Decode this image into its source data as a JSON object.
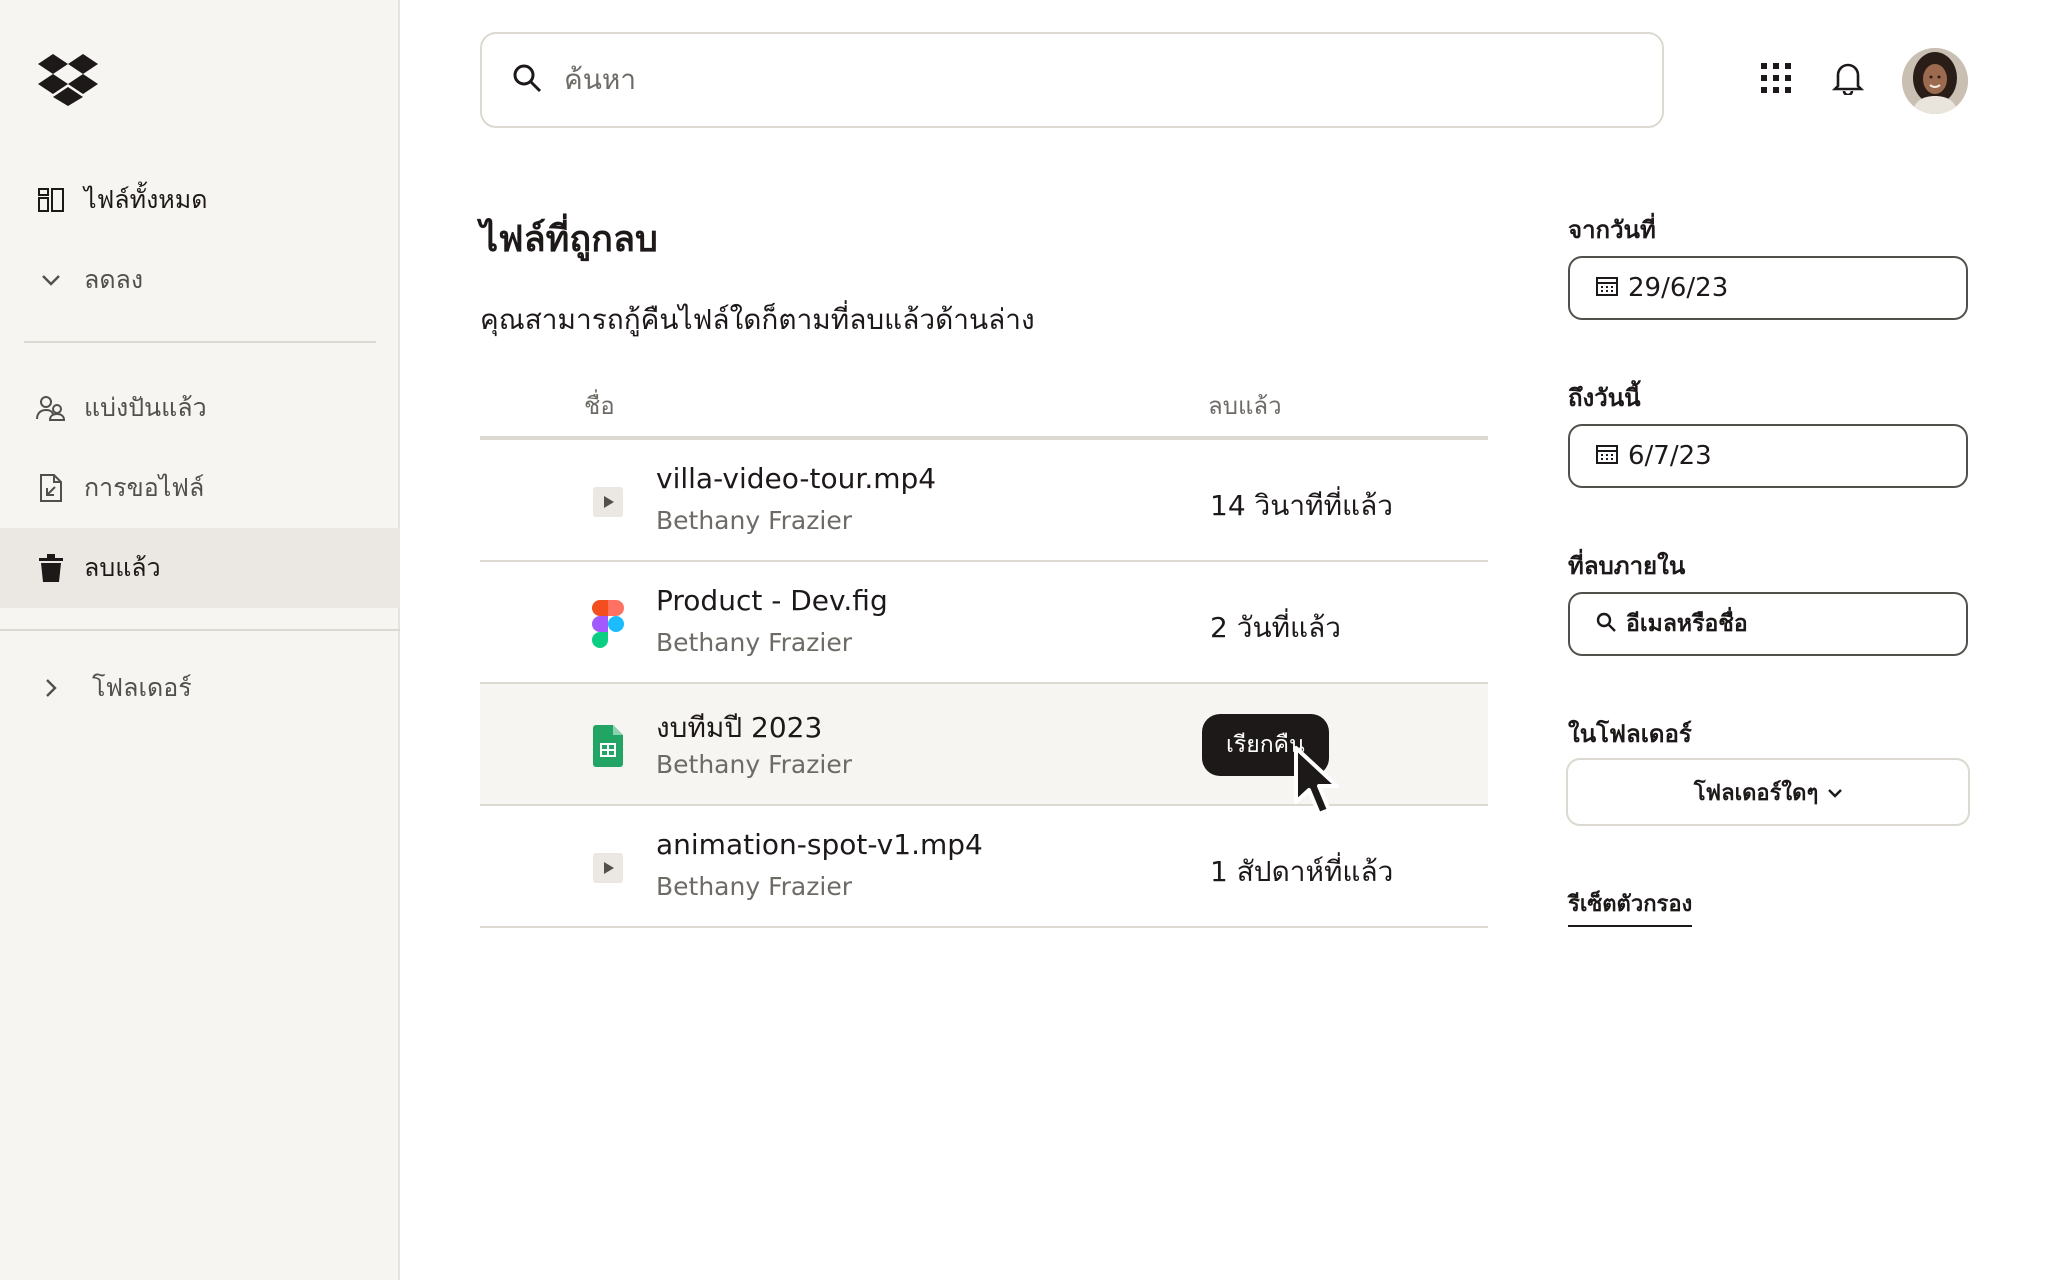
{
  "sidebar": {
    "logo": "dropbox-logo",
    "nav": [
      {
        "label": "ไฟล์ทั้งหมด",
        "icon": "files-icon"
      },
      {
        "label": "ลดลง",
        "icon": "chevron-down-icon"
      },
      {
        "label": "แบ่งปันแล้ว",
        "icon": "shared-icon"
      },
      {
        "label": "การขอไฟล์",
        "icon": "file-request-icon"
      },
      {
        "label": "ลบแล้ว",
        "icon": "trash-icon"
      },
      {
        "label": "โฟลเดอร์",
        "icon": "chevron-right-icon"
      }
    ]
  },
  "header": {
    "search_placeholder": "ค้นหา",
    "icons": [
      "apps-grid-icon",
      "bell-icon"
    ],
    "avatar": "user-avatar"
  },
  "main": {
    "title": "ไฟล์ที่ถูกลบ",
    "subtitle": "คุณสามารถกู้คืนไฟล์ใดก็ตามที่ลบแล้วด้านล่าง",
    "columns": {
      "name": "ชื่อ",
      "deleted": "ลบแล้ว"
    },
    "rows": [
      {
        "name": "villa-video-tour.mp4",
        "owner": "Bethany Frazier",
        "deleted": "14 วินาทีที่แล้ว",
        "icon": "video-file-icon"
      },
      {
        "name": "Product - Dev.fig",
        "owner": "Bethany Frazier",
        "deleted": "2 วันที่แล้ว",
        "icon": "figma-file-icon"
      },
      {
        "name": "งบทีมปี 2023",
        "owner": "Bethany Frazier",
        "deleted": "",
        "icon": "sheets-file-icon",
        "action": "เรียกคืน"
      },
      {
        "name": "animation-spot-v1.mp4",
        "owner": "Bethany Frazier",
        "deleted": "1 สัปดาห์ที่แล้ว",
        "icon": "video-file-icon"
      }
    ]
  },
  "filters": {
    "from_label": "จากวันที่",
    "from_value": "29/6/23",
    "to_label": "ถึงวันนี้",
    "to_value": "6/7/23",
    "deleted_by_label": "ที่ลบภายใน",
    "deleted_by_placeholder": "อีเมลหรือชื่อ",
    "folder_label": "ในโฟลเดอร์",
    "folder_value": "โฟลเดอร์ใดๆ",
    "reset_label": "รีเซ็ตตัวกรอง"
  },
  "colors": {
    "sidebar_bg": "#f7f5f2",
    "text": "#1e1919",
    "muted": "#6e6b66",
    "border": "#dcd8d2",
    "button_dark": "#1e1919"
  }
}
